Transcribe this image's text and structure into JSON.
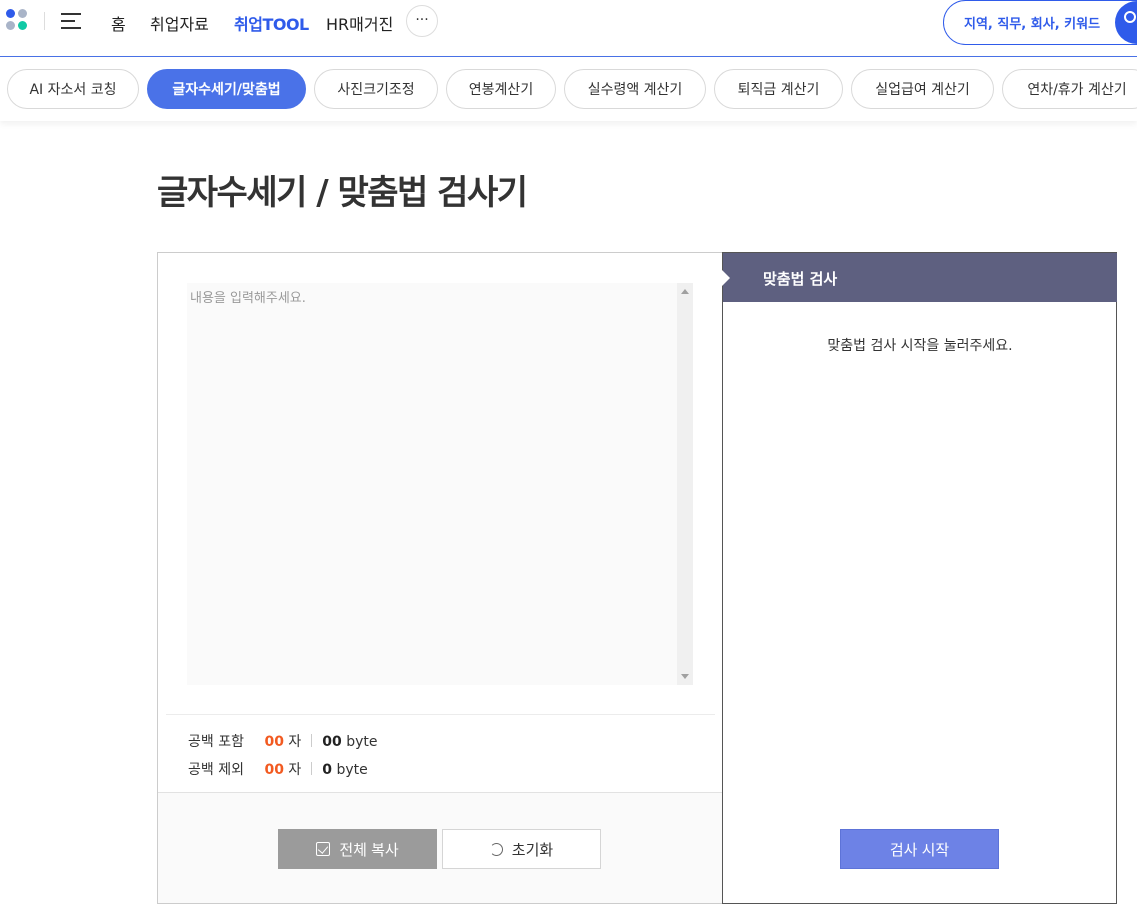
{
  "nav": {
    "home": "홈",
    "job_data": "취업자료",
    "job_tool": "취업TOOL",
    "hr_magazine": "HR매거진",
    "more": "···",
    "search_placeholder": "지역, 직무, 회사, 키워드",
    "accent_color": "#2f5bea"
  },
  "tabs": [
    {
      "label": "AI 자소서 코칭"
    },
    {
      "label": "글자수세기/맞춤법"
    },
    {
      "label": "사진크기조정"
    },
    {
      "label": "연봉계산기"
    },
    {
      "label": "실수령액 계산기"
    },
    {
      "label": "퇴직금 계산기"
    },
    {
      "label": "실업급여 계산기"
    },
    {
      "label": "연차/휴가 계산기"
    }
  ],
  "page": {
    "title": "글자수세기 / 맞춤법 검사기"
  },
  "editor": {
    "placeholder": "내용을 입력해주세요.",
    "with_space_label": "공백 포함",
    "with_space_count": "00",
    "without_space_label": "공백 제외",
    "without_space_count": "00",
    "char_unit": "자",
    "with_space_bytes": "00",
    "without_space_bytes": "0",
    "byte_unit": "byte",
    "copy_all_label": "전체 복사",
    "reset_label": "초기화"
  },
  "spell": {
    "header": "맞춤법 검사",
    "message": "맞춤법 검사 시작을 눌러주세요.",
    "start_label": "검사 시작",
    "header_color": "#5e6080"
  }
}
